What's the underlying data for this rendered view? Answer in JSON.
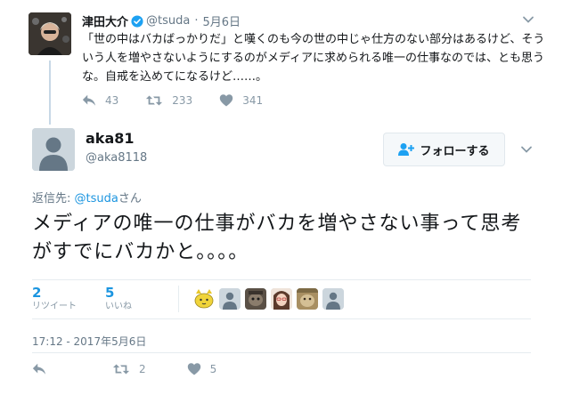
{
  "parent_tweet": {
    "name": "津田大介",
    "handle": "@tsuda",
    "separator": "·",
    "date": "5月6日",
    "text": "「世の中はバカばっかりだ」と嘆くのも今の世の中じゃ仕方のない部分はあるけど、そういう人を増やさないようにするのがメディアに求められる唯一の仕事なのでは、とも思うな。自戒を込めてになるけど……。",
    "reply_count": "43",
    "retweet_count": "233",
    "like_count": "341"
  },
  "main_tweet": {
    "name": "aka81",
    "handle": "@aka8118",
    "follow_label": "フォローする",
    "reply_prefix": "返信先: ",
    "reply_mention": "@tsuda",
    "reply_suffix": "さん",
    "text": "メディアの唯一の仕事がバカを増やさない事って思考がすでにバカかと。。。。",
    "retweets_num": "2",
    "retweets_label": "リツイート",
    "likes_num": "5",
    "likes_label": "いいね",
    "timestamp": "17:12 - 2017年5月6日",
    "reply_count": "",
    "retweet_count": "2",
    "like_count": "5"
  },
  "icons": [
    "verified-badge-icon",
    "chevron-down-icon",
    "reply-icon",
    "retweet-icon",
    "heart-icon",
    "follow-user-plus-icon"
  ],
  "colors": {
    "link": "#1b95e0",
    "muted": "#657786",
    "action": "#8899a6",
    "thread_line": "#c7d8e6",
    "verified": "#1da1f2"
  }
}
